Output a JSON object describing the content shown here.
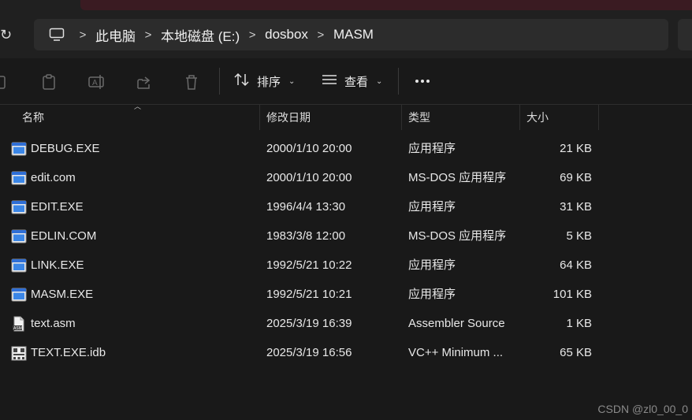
{
  "address": {
    "breadcrumbs": [
      "此电脑",
      "本地磁盘 (E:)",
      "dosbox",
      "MASM"
    ]
  },
  "toolbar": {
    "sort_label": "排序",
    "view_label": "查看"
  },
  "columns": {
    "name": "名称",
    "date": "修改日期",
    "type": "类型",
    "size": "大小"
  },
  "files": [
    {
      "name": "DEBUG.EXE",
      "date": "2000/1/10 20:00",
      "type": "应用程序",
      "size": "21 KB",
      "icon": "exe-icon"
    },
    {
      "name": "edit.com",
      "date": "2000/1/10 20:00",
      "type": "MS-DOS 应用程序",
      "size": "69 KB",
      "icon": "exe-icon"
    },
    {
      "name": "EDIT.EXE",
      "date": "1996/4/4 13:30",
      "type": "应用程序",
      "size": "31 KB",
      "icon": "exe-icon"
    },
    {
      "name": "EDLIN.COM",
      "date": "1983/3/8 12:00",
      "type": "MS-DOS 应用程序",
      "size": "5 KB",
      "icon": "exe-icon"
    },
    {
      "name": "LINK.EXE",
      "date": "1992/5/21 10:22",
      "type": "应用程序",
      "size": "64 KB",
      "icon": "exe-icon"
    },
    {
      "name": "MASM.EXE",
      "date": "1992/5/21 10:21",
      "type": "应用程序",
      "size": "101 KB",
      "icon": "exe-icon"
    },
    {
      "name": "text.asm",
      "date": "2025/3/19 16:39",
      "type": "Assembler Source",
      "size": "1 KB",
      "icon": "asm-file-icon"
    },
    {
      "name": "TEXT.EXE.idb",
      "date": "2025/3/19 16:56",
      "type": "VC++ Minimum ...",
      "size": "65 KB",
      "icon": "idb-file-icon"
    }
  ],
  "watermark": "CSDN @zl0_00_0"
}
